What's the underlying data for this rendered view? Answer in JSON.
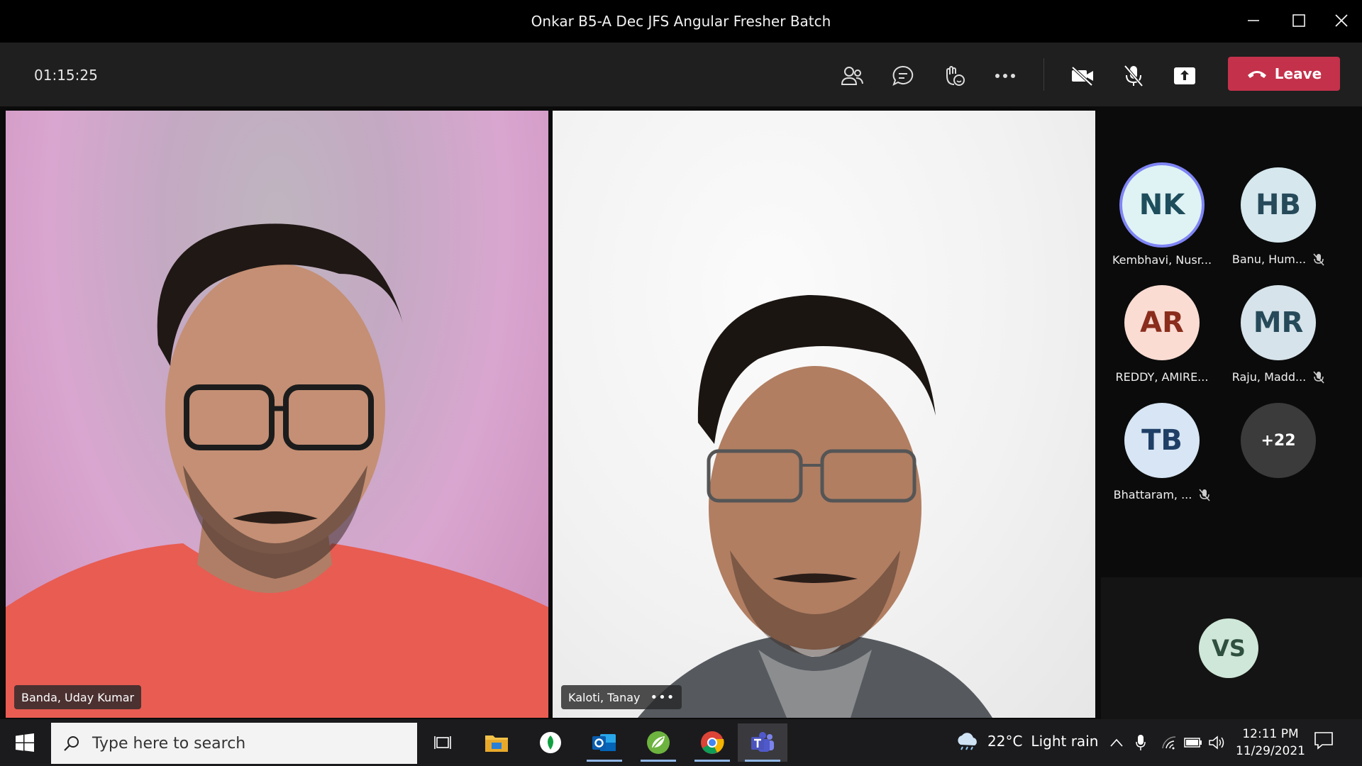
{
  "window": {
    "title": "Onkar B5-A Dec JFS Angular Fresher Batch"
  },
  "meeting": {
    "elapsed": "01:15:25",
    "toolbar_icons": [
      "participants-icon",
      "chat-icon",
      "reactions-icon",
      "more-options-icon",
      "camera-off-icon",
      "mic-off-icon",
      "share-icon"
    ],
    "leave_label": "Leave",
    "leave_color": "#c4314b"
  },
  "videos": [
    {
      "name": "Banda, Uday Kumar"
    },
    {
      "name": "Kaloti, Tanay"
    }
  ],
  "roster": [
    {
      "initials": "NK",
      "name": "Kembhavi, Nusr...",
      "muted": false,
      "bg": "#dff3f4",
      "fg": "#1e4d5c",
      "speaking": true
    },
    {
      "initials": "HB",
      "name": "Banu, Hum...",
      "muted": true,
      "bg": "#d6e7ee",
      "fg": "#264a5a",
      "speaking": false
    },
    {
      "initials": "AR",
      "name": "REDDY, AMIRE...",
      "muted": false,
      "bg": "#fadcd3",
      "fg": "#8a2d1c",
      "speaking": false
    },
    {
      "initials": "MR",
      "name": "Raju, Madd...",
      "muted": true,
      "bg": "#d6e3ea",
      "fg": "#264a5a",
      "speaking": false
    },
    {
      "initials": "TB",
      "name": "Bhattaram, ...",
      "muted": true,
      "bg": "#d7e5f4",
      "fg": "#1f3f66",
      "speaking": false
    }
  ],
  "overflow": {
    "label": "+22"
  },
  "self": {
    "initials": "VS"
  },
  "taskbar": {
    "search_placeholder": "Type here to search",
    "weather_temp": "22°C",
    "weather_desc": "Light rain",
    "time": "12:11 PM",
    "date": "11/29/2021"
  }
}
